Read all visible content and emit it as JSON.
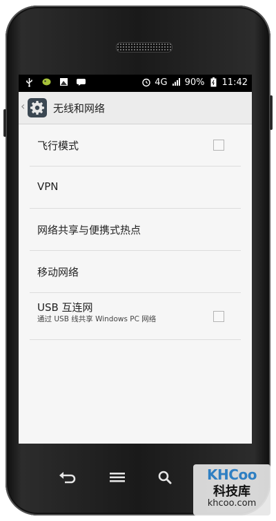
{
  "statusbar": {
    "network": "4G",
    "battery": "90%",
    "time": "11:42"
  },
  "actionbar": {
    "title": "无线和网络"
  },
  "settings": {
    "items": [
      {
        "label": "飞行模式",
        "has_checkbox": true,
        "checked": false
      },
      {
        "label": "VPN"
      },
      {
        "label": "网络共享与便携式热点"
      },
      {
        "label": "移动网络"
      },
      {
        "label": "USB 互连网",
        "sub": "通过 USB 线共享 Windows PC 网络",
        "has_checkbox": true,
        "checked": false
      }
    ]
  },
  "navbar": {
    "buttons": [
      "back-icon",
      "menu-icon",
      "search-icon"
    ]
  },
  "watermark": {
    "logo": "KHCoo",
    "name": "科技库",
    "url": "khcoo.com"
  },
  "colors": {
    "screen_bg": "#f6f6f6",
    "actionbar_bg": "#ececec",
    "statusbar_bg": "#000000",
    "brand_blue": "#2f7fc2"
  }
}
